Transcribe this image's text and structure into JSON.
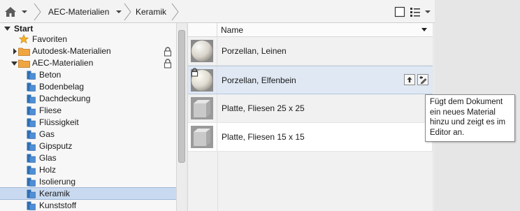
{
  "breadcrumb": {
    "segments": [
      "AEC-Materialien",
      "Keramik"
    ]
  },
  "view": {
    "layout_icon": "single-pane-icon",
    "list_icon": "list-view-icon"
  },
  "tree": {
    "root": "Start",
    "items": [
      {
        "label": "Favoriten",
        "icon": "star-icon"
      },
      {
        "label": "Autodesk-Materialien",
        "icon": "folder-icon",
        "locked": true
      },
      {
        "label": "AEC-Materialien",
        "icon": "folder-icon",
        "locked": true
      },
      {
        "label": "Beton",
        "icon": "material-category-icon"
      },
      {
        "label": "Bodenbelag",
        "icon": "material-category-icon"
      },
      {
        "label": "Dachdeckung",
        "icon": "material-category-icon"
      },
      {
        "label": "Fliese",
        "icon": "material-category-icon"
      },
      {
        "label": "Flüssigkeit",
        "icon": "material-category-icon"
      },
      {
        "label": "Gas",
        "icon": "material-category-icon"
      },
      {
        "label": "Gipsputz",
        "icon": "material-category-icon"
      },
      {
        "label": "Glas",
        "icon": "material-category-icon"
      },
      {
        "label": "Holz",
        "icon": "material-category-icon"
      },
      {
        "label": "Isolierung",
        "icon": "material-category-icon"
      },
      {
        "label": "Keramik",
        "icon": "material-category-icon",
        "selected": true
      },
      {
        "label": "Kunststoff",
        "icon": "material-category-icon"
      }
    ]
  },
  "list": {
    "column_header": "Name",
    "rows": [
      {
        "name": "Porzellan, Leinen",
        "thumbnail": "sphere"
      },
      {
        "name": "Porzellan, Elfenbein",
        "thumbnail": "sphere",
        "locked": true,
        "hovered": true
      },
      {
        "name": "Platte, Fliesen 25 x 25",
        "thumbnail": "cube"
      },
      {
        "name": "Platte, Fliesen 15 x 15",
        "thumbnail": "cube"
      }
    ]
  },
  "tooltip": {
    "text": "Fügt dem Dokument\nein neues Material\nhinzu und zeigt es im\nEditor an."
  },
  "colors": {
    "selection": "#c9daf0",
    "folder": "#f0a640",
    "category_icon": "#2f6fb5",
    "star": "#f4b326"
  }
}
